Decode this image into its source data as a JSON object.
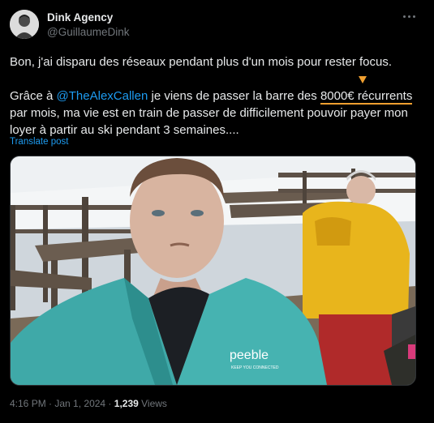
{
  "author": {
    "display_name": "Dink Agency",
    "handle": "@GuillaumeDink"
  },
  "tweet": {
    "line1": "Bon, j'ai disparu des réseaux pendant plus d'un mois pour rester focus.",
    "p2_before": "Grâce à ",
    "mention": "@TheAlexCallen",
    "p2_middle": " je viens de passer la barre des ",
    "highlight": "8000€ récurrents",
    "p2_after": " par mois, ma vie est en train de passer de difficilement pouvoir payer mon loyer à partir au ski pendant 3 semaines....",
    "translate_label": "Translate post"
  },
  "photo": {
    "jacket_text": "peeble",
    "jacket_subtext": "KEEP YOU CONNECTED"
  },
  "meta": {
    "time": "4:16 PM",
    "sep1": " · ",
    "date": "Jan 1, 2024",
    "sep2": " · ",
    "views_count": "1,239",
    "views_label": " Views"
  },
  "colors": {
    "background": "#000000",
    "text": "#e7e9ea",
    "muted": "#71767b",
    "link": "#1d9bf0",
    "highlight_underline": "#f0a030"
  },
  "icons": [
    "more-options-icon",
    "down-arrow-annotation-icon"
  ]
}
